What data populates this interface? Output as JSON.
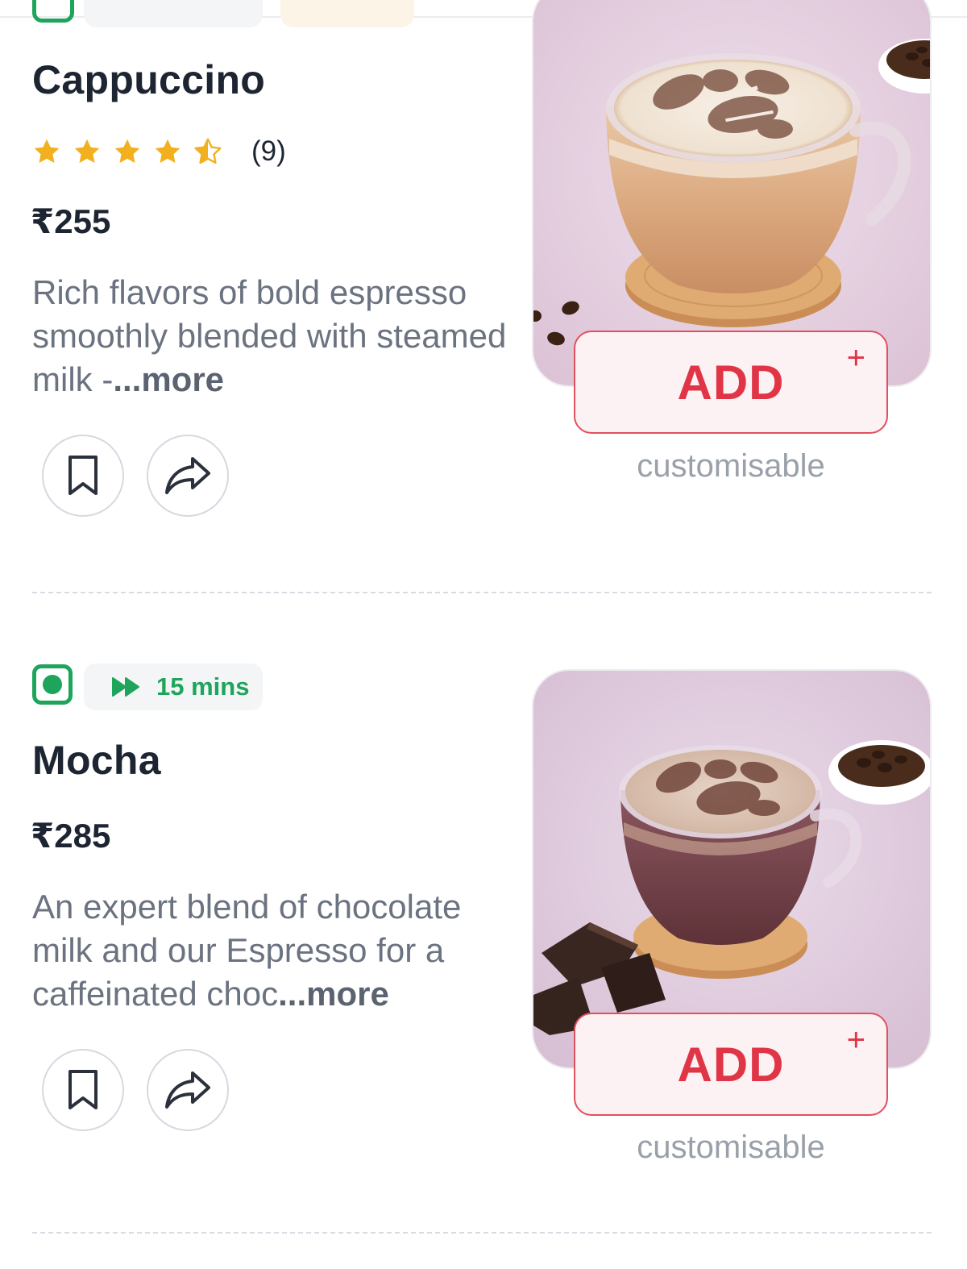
{
  "items": [
    {
      "name": "Cappuccino",
      "rating": 4.5,
      "rating_count": "(9)",
      "price": "₹255",
      "description": "Rich flavors of bold espresso smoothly blended with steamed milk -",
      "more_label": "...more",
      "bookmark_icon": "bookmark-icon",
      "share_icon": "share-icon",
      "add_label": "ADD",
      "add_plus": "+",
      "customisable_label": "customisable"
    },
    {
      "name": "Mocha",
      "veg_indicator_icon": "veg-indicator-icon",
      "delivery_time": "15 mins",
      "time_icon": "fast-forward-icon",
      "price": "₹285",
      "description": "An expert blend of chocolate milk and our Espresso for a caffeinated choc",
      "more_label": "...more",
      "bookmark_icon": "bookmark-icon",
      "share_icon": "share-icon",
      "add_label": "ADD",
      "add_plus": "+",
      "customisable_label": "customisable"
    }
  ],
  "colors": {
    "accent_red": "#e03546",
    "veg_green": "#1ea55b",
    "star_gold": "#f2b01e",
    "text_dark": "#1d2532",
    "text_grey": "#6b7380",
    "image_bg": "#e6d2e2"
  }
}
